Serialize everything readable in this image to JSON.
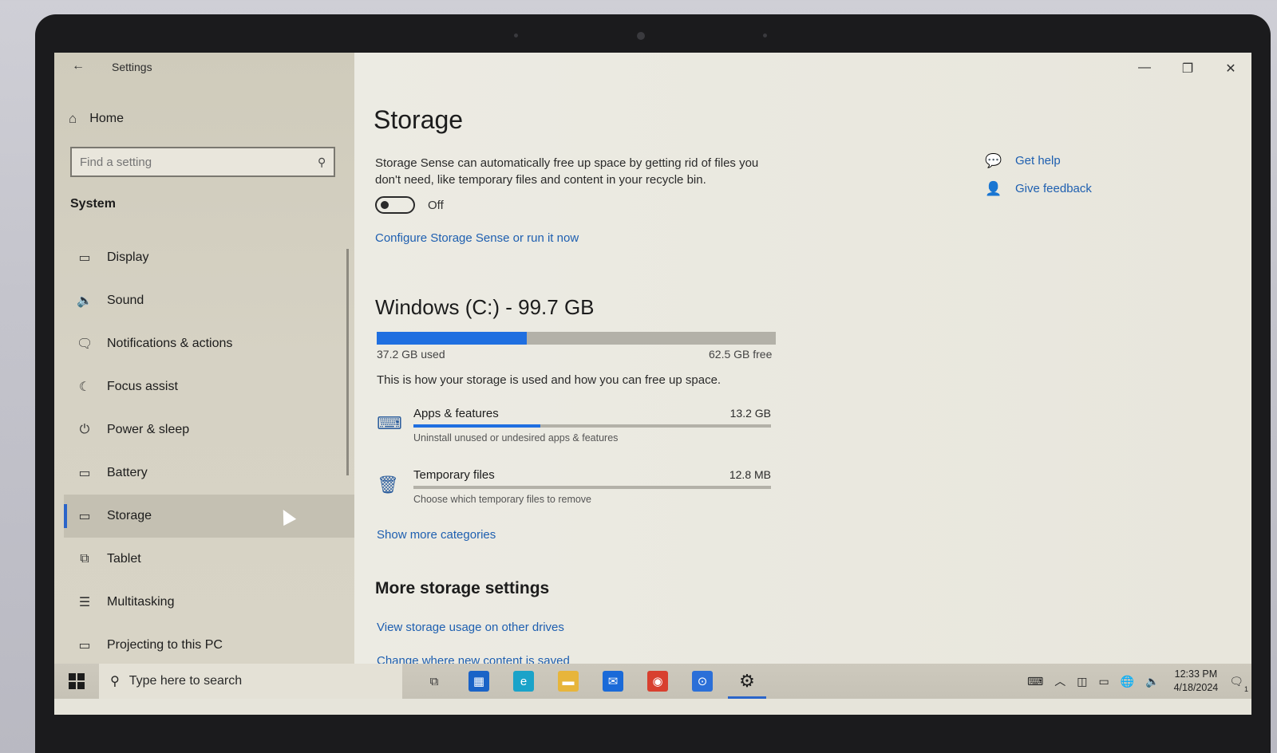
{
  "window": {
    "title": "Settings",
    "back_glyph": "←",
    "controls": {
      "minimize": "—",
      "maximize": "❐",
      "close": "✕"
    }
  },
  "sidebar": {
    "home_label": "Home",
    "search_placeholder": "Find a setting",
    "section_label": "System",
    "items": [
      {
        "label": "Display",
        "icon": "display-icon",
        "glyph": "▭"
      },
      {
        "label": "Sound",
        "icon": "speaker-icon",
        "glyph": "🔈"
      },
      {
        "label": "Notifications & actions",
        "icon": "notification-icon",
        "glyph": "🗨"
      },
      {
        "label": "Focus assist",
        "icon": "moon-icon",
        "glyph": "☾"
      },
      {
        "label": "Power & sleep",
        "icon": "power-icon",
        "glyph": "⏻"
      },
      {
        "label": "Battery",
        "icon": "battery-icon",
        "glyph": "▭"
      },
      {
        "label": "Storage",
        "icon": "storage-icon",
        "glyph": "▭",
        "active": true
      },
      {
        "label": "Tablet",
        "icon": "tablet-icon",
        "glyph": "⧉"
      },
      {
        "label": "Multitasking",
        "icon": "multitasking-icon",
        "glyph": "☰"
      },
      {
        "label": "Projecting to this PC",
        "icon": "projector-icon",
        "glyph": "▭"
      }
    ]
  },
  "main": {
    "title": "Storage",
    "sense_description": "Storage Sense can automatically free up space by getting rid of files you don't need, like temporary files and content in your recycle bin.",
    "sense_toggle_state": "Off",
    "configure_link": "Configure Storage Sense or run it now",
    "drive": {
      "title": "Windows (C:) - 99.7 GB",
      "used_label": "37.2 GB used",
      "free_label": "62.5 GB free",
      "used_fraction": 0.376
    },
    "how_text": "This is how your storage is used and how you can free up space.",
    "categories": [
      {
        "name": "Apps & features",
        "size": "13.2 GB",
        "sub": "Uninstall unused or undesired apps & features",
        "fraction": 0.355,
        "icon": "keyboard-icon",
        "glyph": "⌨"
      },
      {
        "name": "Temporary files",
        "size": "12.8 MB",
        "sub": "Choose which temporary files to remove",
        "fraction": 0.0,
        "icon": "trash-icon",
        "glyph": "🗑"
      }
    ],
    "show_more_link": "Show more categories",
    "more_title": "More storage settings",
    "more_links": [
      "View storage usage on other drives",
      "Change where new content is saved"
    ],
    "help": {
      "get_help": "Get help",
      "give_feedback": "Give feedback"
    }
  },
  "taskbar": {
    "search_placeholder": "Type here to search",
    "apps": [
      {
        "name": "task-view",
        "glyph": "⧉",
        "bg": "transparent",
        "fg": "#333333"
      },
      {
        "name": "microsoft-store",
        "glyph": "▦",
        "bg": "#1a63c7",
        "fg": "#ffffff"
      },
      {
        "name": "edge",
        "glyph": "e",
        "bg": "#1aa3c9",
        "fg": "#ffffff"
      },
      {
        "name": "file-explorer",
        "glyph": "▬",
        "bg": "#e7b53b",
        "fg": "#ffffff"
      },
      {
        "name": "mail",
        "glyph": "✉",
        "bg": "#1a6ad8",
        "fg": "#ffffff"
      },
      {
        "name": "chrome",
        "glyph": "◉",
        "bg": "#d8402f",
        "fg": "#ffffff"
      },
      {
        "name": "app-blue",
        "glyph": "⊙",
        "bg": "#2b6fd8",
        "fg": "#ffffff"
      },
      {
        "name": "settings",
        "glyph": "⚙",
        "bg": "transparent",
        "fg": "#1c1c1c",
        "active": true
      }
    ],
    "tray": {
      "time": "12:33 PM",
      "date": "4/18/2024",
      "notifications_count": "1"
    }
  },
  "colors": {
    "accent": "#1f6fe0",
    "link": "#1e5fb0"
  }
}
